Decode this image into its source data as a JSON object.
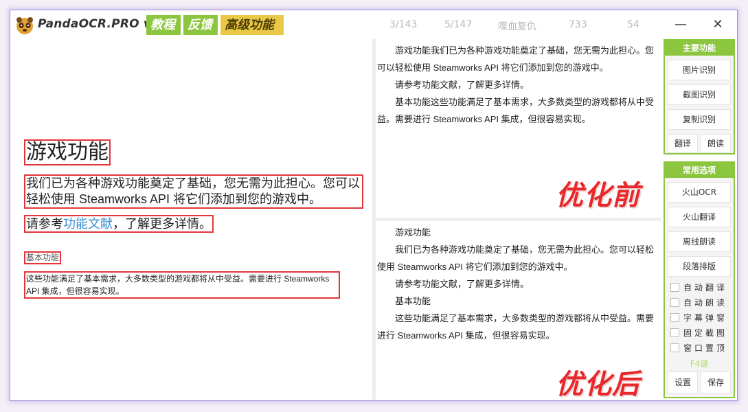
{
  "titlebar": {
    "app_title": "PandaOCR.PRO v5.46",
    "tags": [
      "教程",
      "反馈",
      "高级功能"
    ],
    "stats": [
      "3/143",
      "5/147",
      "喋血复仇",
      "733",
      "54"
    ],
    "minimize_glyph": "—",
    "close_glyph": "✕"
  },
  "preview": {
    "heading": "游戏功能",
    "para1": "我们已为各种游戏功能奠定了基础，您无需为此担心。您可以轻松使用 Steamworks API 将它们添加到您的游戏中。",
    "para2_prefix": "请参考",
    "para2_link": "功能文献",
    "para2_suffix": "，了解更多详情。",
    "subheading": "基本功能",
    "para3": "这些功能满足了基本需求，大多数类型的游戏都将从中受益。需要进行 Steamworks API 集成，但很容易实现。"
  },
  "ocr_before": {
    "lines": [
      "游戏功能我们已为各种游戏功能奠定了基础，您无需为此担心。您可以轻松使用 Steamworks API 将它们添加到您的游戏中。",
      "请参考功能文献，了解更多详情。",
      "基本功能这些功能满足了基本需求，大多数类型的游戏都将从中受益。需要进行 Steamworks API 集成，但很容易实现。"
    ],
    "label": "优化前"
  },
  "ocr_after": {
    "lines": [
      "游戏功能",
      "我们已为各种游戏功能奠定了基础，您无需为此担心。您可以轻松使用 Steamworks API 将它们添加到您的游戏中。",
      "请参考功能文献，了解更多详情。",
      "基本功能",
      "这些功能满足了基本需求，大多数类型的游戏都将从中受益。需要进行 Steamworks API 集成，但很容易实现。"
    ],
    "label": "优化后"
  },
  "panel": {
    "main_title": "主要功能",
    "main_buttons": [
      "图片识别",
      "截图识别",
      "复制识别"
    ],
    "translate": "翻译",
    "read": "朗读",
    "common_title": "常用选项",
    "common_buttons": [
      "火山OCR",
      "火山翻译",
      "离线朗读",
      "段落排版"
    ],
    "checkboxes": [
      "自动翻译",
      "自动朗读",
      "字幕弹窗",
      "固定截图",
      "窗口置顶"
    ],
    "f4": "F4键",
    "settings": "设置",
    "save": "保存"
  },
  "colors": {
    "accent_green": "#8cc63f",
    "tag_yellow": "#e9c847",
    "highlight_red": "#e0363a",
    "watermark_red": "#e8282b",
    "link_blue": "#3b8fd0"
  }
}
